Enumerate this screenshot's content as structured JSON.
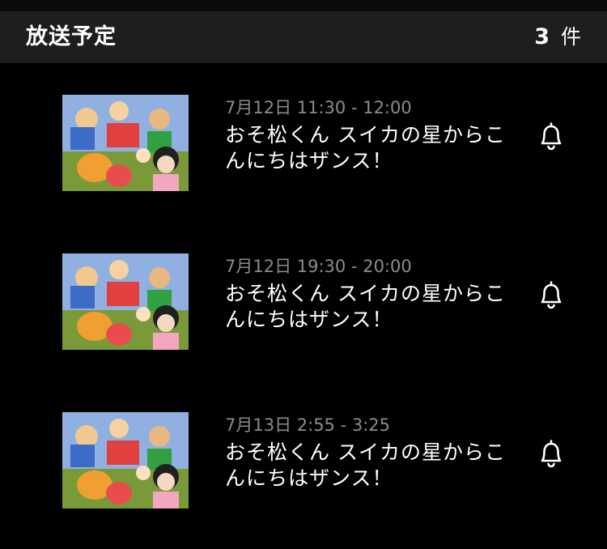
{
  "header": {
    "title": "放送予定",
    "count": "3",
    "count_unit": "件"
  },
  "items": [
    {
      "time": "7月12日 11:30 - 12:00",
      "title": "おそ松くん スイカの星からこんにちはザンス！",
      "bell_icon": "bell-icon"
    },
    {
      "time": "7月12日 19:30 - 20:00",
      "title": "おそ松くん スイカの星からこんにちはザンス！",
      "bell_icon": "bell-icon"
    },
    {
      "time": "7月13日 2:55 - 3:25",
      "title": "おそ松くん スイカの星からこんにちはザンス！",
      "bell_icon": "bell-icon"
    }
  ],
  "colors": {
    "background": "#000000",
    "header_bg": "#1e1e1e",
    "time_text": "#8c8c8c",
    "title_text": "#ffffff"
  }
}
